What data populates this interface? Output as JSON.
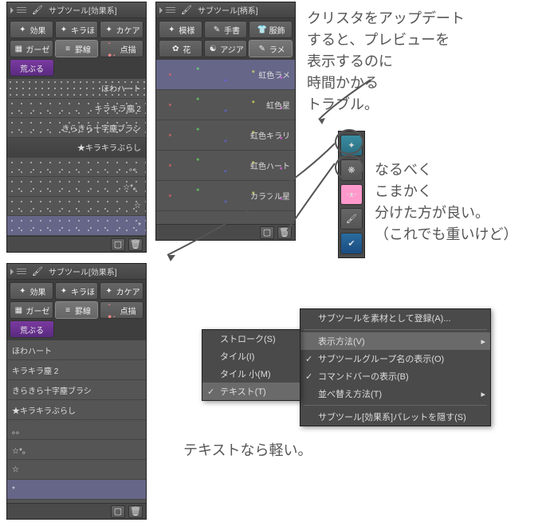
{
  "panel1": {
    "title": "サブツール[効果系]",
    "tabs_row1": [
      "効果",
      "キラほ",
      "カケア"
    ],
    "tabs_row2": [
      "ガーゼ",
      "罫線",
      "点描"
    ],
    "tabs_row3": [
      "荒ぶる"
    ],
    "items": [
      "ほわハート",
      "キラキラ塵 2",
      "きらきら十字塵ブラシ",
      "★キラキラぶらし",
      "。。",
      "☆*。",
      "☆",
      "*"
    ]
  },
  "panel2": {
    "title": "サブツール[柄系]",
    "tabs_row1": [
      "模様",
      "手書",
      "服飾"
    ],
    "tabs_row2": [
      "花",
      "アジア",
      "ラメ"
    ],
    "items": [
      "虹色ラメ",
      "虹色星",
      "虹色キラリ",
      "虹色ハート",
      "カラフル星"
    ]
  },
  "panel3": {
    "title": "サブツール[効果系]",
    "tabs_row1": [
      "効果",
      "キラほ",
      "カケア"
    ],
    "tabs_row2": [
      "ガーゼ",
      "罫線",
      "点描"
    ],
    "tabs_row3": [
      "荒ぶる"
    ],
    "items": [
      "ほわハート",
      "キラキラ塵 2",
      "きらきら十字塵ブラシ",
      "★キラキラぶらし",
      "。。",
      "☆*。",
      "☆",
      "*"
    ]
  },
  "submenu1": {
    "items": [
      "ストローク(S)",
      "タイル(I)",
      "タイル 小(M)",
      "テキスト(T)"
    ]
  },
  "submenu2": {
    "items": [
      "サブツールを素材として登録(A)...",
      "表示方法(V)",
      "サブツールグループ名の表示(O)",
      "コマンドバーの表示(B)",
      "並べ替え方法(T)",
      "サブツール[効果系]パレットを隠す(S)"
    ]
  },
  "hand1": "クリスタをアップデート\nすると、プレビューを\n表示するのに\n時間かかる\nトラブル。",
  "hand2": "なるべく\nこまかく\n分けた方が良い。\n（これでも重いけど）",
  "hand3": "テキストなら軽い。",
  "icons": {
    "sparkle": "✦",
    "gauze": "▦",
    "ruled": "≡",
    "dots": "･･",
    "purple": "■",
    "pattern": "✦",
    "hand": "✎",
    "clothes": "👕",
    "flower": "✿",
    "asia": "☯",
    "lame": "✎",
    "new": "▢",
    "trash": "🗑",
    "face": "･ᴥ･",
    "brush": "🖌"
  }
}
